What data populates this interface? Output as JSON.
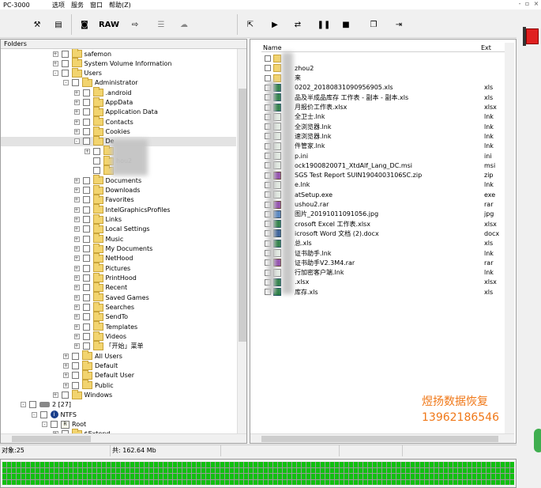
{
  "app": {
    "title": "PC-3000",
    "menu": [
      "选项",
      "服务",
      "窗口",
      "帮助(Z)"
    ]
  },
  "toolbar": {
    "raw_label": "RAW"
  },
  "folders": {
    "header": "Folders",
    "nodes": [
      {
        "label": "safemon",
        "exp": "+"
      },
      {
        "label": "System Volume Information",
        "exp": "+"
      },
      {
        "label": "Users",
        "exp": "-"
      },
      {
        "label": "Administrator",
        "exp": "-"
      },
      {
        "label": ".android",
        "exp": "+"
      },
      {
        "label": "AppData",
        "exp": "+"
      },
      {
        "label": "Application Data",
        "exp": "+"
      },
      {
        "label": "Contacts",
        "exp": "+"
      },
      {
        "label": "Cookies",
        "exp": "+"
      },
      {
        "label": "De",
        "exp": "-"
      },
      {
        "label": "",
        "exp": "+"
      },
      {
        "label": "hou2",
        "exp": ""
      },
      {
        "label": "",
        "exp": ""
      },
      {
        "label": "Documents",
        "exp": "+"
      },
      {
        "label": "Downloads",
        "exp": "+"
      },
      {
        "label": "Favorites",
        "exp": "+"
      },
      {
        "label": "IntelGraphicsProfiles",
        "exp": "+"
      },
      {
        "label": "Links",
        "exp": "+"
      },
      {
        "label": "Local Settings",
        "exp": "+"
      },
      {
        "label": "Music",
        "exp": "+"
      },
      {
        "label": "My Documents",
        "exp": "+"
      },
      {
        "label": "NetHood",
        "exp": "+"
      },
      {
        "label": "Pictures",
        "exp": "+"
      },
      {
        "label": "PrintHood",
        "exp": "+"
      },
      {
        "label": "Recent",
        "exp": "+"
      },
      {
        "label": "Saved Games",
        "exp": "+"
      },
      {
        "label": "Searches",
        "exp": "+"
      },
      {
        "label": "SendTo",
        "exp": "+"
      },
      {
        "label": "Templates",
        "exp": "+"
      },
      {
        "label": "Videos",
        "exp": "+"
      },
      {
        "label": "「开始」菜单",
        "exp": "+"
      },
      {
        "label": "All Users",
        "exp": "+"
      },
      {
        "label": "Default",
        "exp": "+"
      },
      {
        "label": "Default User",
        "exp": "+"
      },
      {
        "label": "Public",
        "exp": "+"
      },
      {
        "label": "Windows",
        "exp": "+"
      },
      {
        "label": "2 [27]",
        "exp": "-"
      },
      {
        "label": "NTFS",
        "exp": "-"
      },
      {
        "label": "Root",
        "exp": "-"
      },
      {
        "label": "$Extend",
        "exp": "+"
      }
    ]
  },
  "files": {
    "col_name": "Name",
    "col_ext": "Ext",
    "rows": [
      {
        "name": "",
        "ext": "",
        "icon": "folder"
      },
      {
        "name": "zhou2",
        "ext": "",
        "icon": "folder"
      },
      {
        "name": "来",
        "ext": "",
        "icon": "folder"
      },
      {
        "name": "0202_20180831090956905.xls",
        "ext": "xls",
        "icon": "xls"
      },
      {
        "name": "品及半成品库存 工作表 - 副本 - 副本.xls",
        "ext": "xls",
        "icon": "xls"
      },
      {
        "name": "月报价工作表.xlsx",
        "ext": "xlsx",
        "icon": "xls"
      },
      {
        "name": "全卫士.lnk",
        "ext": "lnk",
        "icon": "lnk"
      },
      {
        "name": "全浏览器.lnk",
        "ext": "lnk",
        "icon": "lnk"
      },
      {
        "name": "速浏览器.lnk",
        "ext": "lnk",
        "icon": "lnk"
      },
      {
        "name": "件管家.lnk",
        "ext": "lnk",
        "icon": "lnk"
      },
      {
        "name": "p.ini",
        "ext": "ini",
        "icon": "lnk"
      },
      {
        "name": "ock1900820071_XtdAlf_Lang_DC.msi",
        "ext": "msi",
        "icon": "lnk"
      },
      {
        "name": "SGS Test Report SUIN1904003106SC.zip",
        "ext": "zip",
        "icon": "rar"
      },
      {
        "name": "e.lnk",
        "ext": "lnk",
        "icon": "lnk"
      },
      {
        "name": "atSetup.exe",
        "ext": "exe",
        "icon": "lnk"
      },
      {
        "name": "ushou2.rar",
        "ext": "rar",
        "icon": "rar"
      },
      {
        "name": "图片_20191011091056.jpg",
        "ext": "jpg",
        "icon": "jpg"
      },
      {
        "name": "crosoft Excel 工作表.xlsx",
        "ext": "xlsx",
        "icon": "xls"
      },
      {
        "name": "icrosoft Word 文档 (2).docx",
        "ext": "docx",
        "icon": "doc"
      },
      {
        "name": "总.xls",
        "ext": "xls",
        "icon": "xls"
      },
      {
        "name": "证书助手.lnk",
        "ext": "lnk",
        "icon": "lnk"
      },
      {
        "name": "证书助手V2.3M4.rar",
        "ext": "rar",
        "icon": "rar"
      },
      {
        "name": "行加密客户端.lnk",
        "ext": "lnk",
        "icon": "lnk"
      },
      {
        "name": ".xlsx",
        "ext": "xlsx",
        "icon": "xls"
      },
      {
        "name": "库存.xls",
        "ext": "xls",
        "icon": "xls"
      }
    ]
  },
  "watermark": {
    "line1": "煜扬数据恢复",
    "line2": "13962186546"
  },
  "status": {
    "objects": "对象:25",
    "total": "共: 162.64 Mb"
  }
}
